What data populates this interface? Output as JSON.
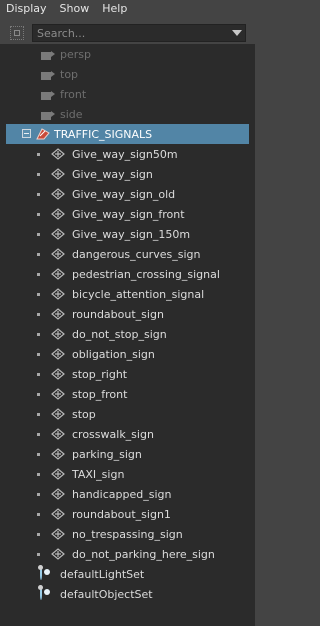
{
  "menubar": {
    "items": [
      "Display",
      "Show",
      "Help"
    ]
  },
  "search": {
    "placeholder": "Search..."
  },
  "cameras": [
    {
      "label": "persp",
      "icon": "camera-icon"
    },
    {
      "label": "top",
      "icon": "camera-icon"
    },
    {
      "label": "front",
      "icon": "camera-icon"
    },
    {
      "label": "side",
      "icon": "camera-icon"
    }
  ],
  "group": {
    "label": "TRAFFIC_SIGNALS",
    "icon": "group-transform-icon",
    "expanded": true,
    "selected": true
  },
  "children": [
    "Give_way_sign50m",
    "Give_way_sign",
    "Give_way_sign_old",
    "Give_way_sign_front",
    "Give_way_sign_150m",
    "dangerous_curves_sign",
    "pedestrian_crossing_signal",
    "bicycle_attention_signal",
    "roundabout_sign",
    "do_not_stop_sign",
    "obligation_sign",
    "stop_right",
    "stop_front",
    "stop",
    "crosswalk_sign",
    "parking_sign",
    "TAXI_sign",
    "handicapped_sign",
    "roundabout_sign1",
    "no_trespassing_sign",
    "do_not_parking_here_sign"
  ],
  "sets": [
    {
      "label": "defaultLightSet",
      "icon": "object-set-icon"
    },
    {
      "label": "defaultObjectSet",
      "icon": "object-set-icon"
    }
  ],
  "colors": {
    "selection": "#5285a6",
    "panel_bg": "#2b2b2b",
    "chrome_bg": "#444444",
    "set_icon": "#3e95c7"
  }
}
